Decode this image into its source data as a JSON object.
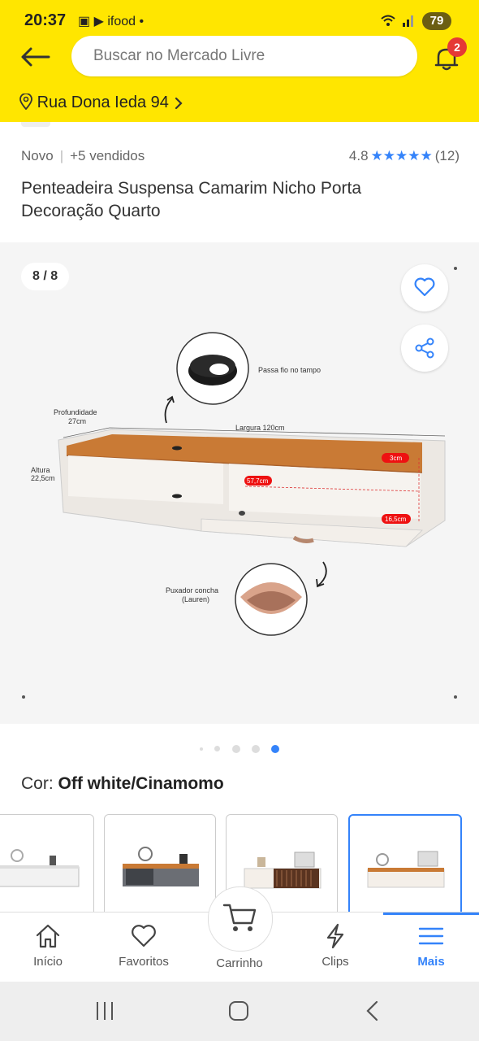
{
  "status_bar": {
    "time": "20:37",
    "left_icons": "▣ ▶ ifood •",
    "battery": "79"
  },
  "header": {
    "search_placeholder": "Buscar no Mercado Livre",
    "notification_count": "2",
    "location": "Rua Dona Ieda 94",
    "accent_color": "#ffe600"
  },
  "product": {
    "condition": "Novo",
    "sold": "+5 vendidos",
    "rating": "4.8",
    "stars": "★★★★★",
    "reviews": "(12)",
    "title": "Penteadeira Suspensa Camarim Nicho Porta Decoração Quarto"
  },
  "gallery": {
    "counter": "8 / 8",
    "image_labels": {
      "passa_fio": "Passa fio no tampo",
      "profundidade": "Profundidade",
      "profundidade_val": "27cm",
      "largura": "Largura 120cm",
      "altura": "Altura",
      "altura_val": "22,5cm",
      "tampo": "3cm",
      "nicho": "57,7cm",
      "porta": "16,5cm",
      "puxador": "Puxador concha",
      "puxador_model": "(Lauren)"
    }
  },
  "variant": {
    "label": "Cor: ",
    "value": "Off white/Cinamomo"
  },
  "nav": {
    "home": "Início",
    "favorites": "Favoritos",
    "cart": "Carrinho",
    "clips": "Clips",
    "more": "Mais"
  },
  "brand_blue": "#3483fa"
}
